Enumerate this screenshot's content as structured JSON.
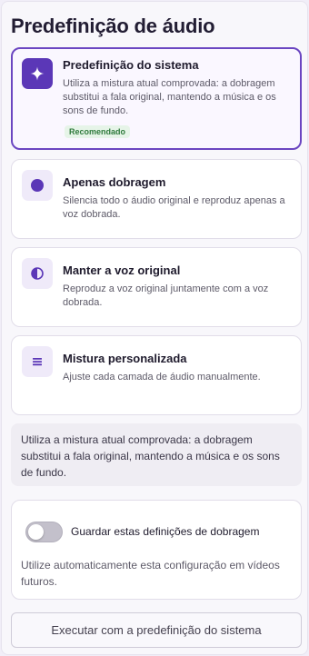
{
  "title": "Predefinição de áudio",
  "options": [
    {
      "title": "Predefinição do sistema",
      "description": "Utiliza a mistura atual comprovada: a dobragem substitui a fala original, mantendo a música e os sons de fundo.",
      "badge": "Recomendado",
      "icon": "sparkle-icon",
      "selected": true
    },
    {
      "title": "Apenas dobragem",
      "description": "Silencia todo o áudio original e reproduz apenas a voz dobrada.",
      "icon": "dot-icon",
      "selected": false
    },
    {
      "title": "Manter a voz original",
      "description": "Reproduz a voz original juntamente com a voz dobrada.",
      "icon": "half-circle-icon",
      "selected": false
    },
    {
      "title": "Mistura personalizada",
      "description": "Ajuste cada camada de áudio manualmente.",
      "icon": "menu-lines-icon",
      "selected": false
    }
  ],
  "summary": "Utiliza a mistura atual comprovada: a dobragem substitui a fala original, mantendo a música e os sons de fundo.",
  "save_settings": {
    "toggle_label": "Guardar estas definições de dobragem",
    "toggle_on": false,
    "description": "Utilize automaticamente esta configuração em vídeos futuros."
  },
  "run_button": "Executar com a predefinição do sistema",
  "colors": {
    "accent": "#6b46c1",
    "accent_dark": "#5b37b7",
    "badge_bg": "#e6f4e8",
    "badge_text": "#2f7a3c"
  }
}
